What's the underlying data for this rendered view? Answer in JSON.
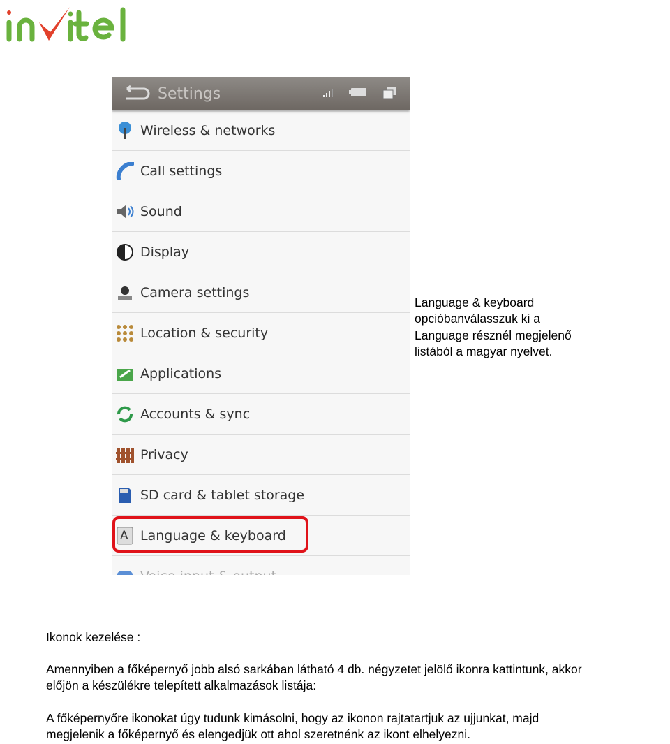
{
  "logo": {
    "text": "invitel",
    "colors": {
      "green": "#6ab23e",
      "red": "#e2402b"
    }
  },
  "phone": {
    "header": {
      "title": "Settings",
      "icons": [
        "back-icon",
        "signal-icon",
        "battery-icon",
        "windows-icon"
      ]
    },
    "items": [
      {
        "label": "Wireless & networks",
        "icon": "wifi-tower-icon"
      },
      {
        "label": "Call settings",
        "icon": "phone-icon"
      },
      {
        "label": "Sound",
        "icon": "speaker-icon"
      },
      {
        "label": "Display",
        "icon": "display-icon"
      },
      {
        "label": "Camera settings",
        "icon": "camera-icon"
      },
      {
        "label": "Location & security",
        "icon": "location-grid-icon"
      },
      {
        "label": "Applications",
        "icon": "applications-icon"
      },
      {
        "label": "Accounts & sync",
        "icon": "sync-icon"
      },
      {
        "label": "Privacy",
        "icon": "fence-icon"
      },
      {
        "label": "SD card & tablet storage",
        "icon": "sd-card-icon"
      },
      {
        "label": "Language & keyboard",
        "icon": "keyboard-a-icon",
        "highlighted": true
      },
      {
        "label": "Voice input & output",
        "icon": "voice-icon"
      }
    ],
    "highlight_color": "#e0131a"
  },
  "side_note": [
    "Language & keyboard",
    "opcióbanválasszuk ki a",
    "Language résznél megjelenő",
    "listából a magyar nyelvet."
  ],
  "section_title": "Ikonok kezelése :",
  "paragraph1": [
    "Amennyiben a főképernyő jobb alsó sarkában látható 4 db. négyzetet jelölő ikonra kattintunk, akkor",
    "előjön a készülékre telepített alkalmazások listája:"
  ],
  "paragraph2": [
    "A főképernyőre ikonokat úgy tudunk kimásolni, hogy az ikonon rajtatartjuk az ujjunkat, majd",
    "megjelenik a főképernyő és elengedjük ott ahol szeretnénk az ikont elhelyezni."
  ]
}
